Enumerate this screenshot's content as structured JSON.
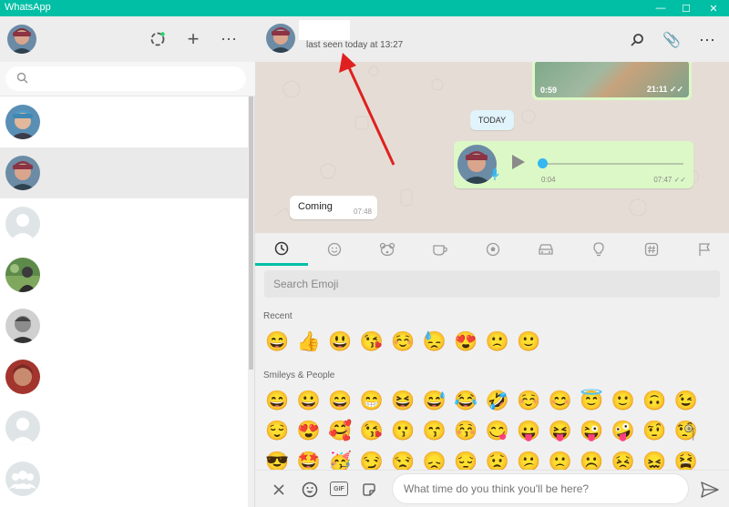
{
  "titlebar": {
    "title": "WhatsApp",
    "minimize_glyph": "—",
    "maximize_glyph": "☐",
    "close_glyph": "✕"
  },
  "sidebar": {
    "new_chat_glyph": "+",
    "menu_glyph": "⋯",
    "search_placeholder": ""
  },
  "chat": {
    "contact_name": "",
    "last_seen": "last seen today at 13:27",
    "attach_glyph": "📎",
    "menu_glyph": "⋯",
    "messages": {
      "video": {
        "duration": "0:59",
        "time": "21:11 ✓✓"
      },
      "date_badge": "TODAY",
      "voice": {
        "duration": "0:04",
        "time": "07:47 ✓✓",
        "progress": 0
      },
      "text": {
        "text": "Coming",
        "time": "07:48"
      }
    }
  },
  "emoji_panel": {
    "search_placeholder": "Search Emoji",
    "recent_label": "Recent",
    "recent": [
      "😄",
      "👍",
      "😃",
      "😘",
      "☺️",
      "😓",
      "😍",
      "🙁",
      "🙂"
    ],
    "smileys_label": "Smileys & People",
    "smileys_row1": [
      "😄",
      "😀",
      "😄",
      "😁",
      "😆",
      "😅",
      "😂",
      "🤣",
      "☺️",
      "😊",
      "😇",
      "🙂",
      "🙃",
      "😉"
    ],
    "smileys_row2": [
      "😌",
      "😍",
      "🥰",
      "😘",
      "😗",
      "😙",
      "😚",
      "😋",
      "😛",
      "😝",
      "😜",
      "🤪",
      "🤨",
      "🧐"
    ],
    "smileys_row3": [
      "😎",
      "🤩",
      "🥳",
      "😏",
      "😒",
      "😞",
      "😔",
      "😟",
      "😕",
      "🙁",
      "☹️",
      "😣",
      "😖",
      "😫"
    ]
  },
  "composer": {
    "placeholder": "What time do you think you'll be here?",
    "gif_label": "GIF"
  },
  "colors": {
    "brand": "#00bfa5",
    "outgoing": "#dcf8c6",
    "chat_bg": "#e5ddd5",
    "annotation_arrow": "#e02020"
  }
}
